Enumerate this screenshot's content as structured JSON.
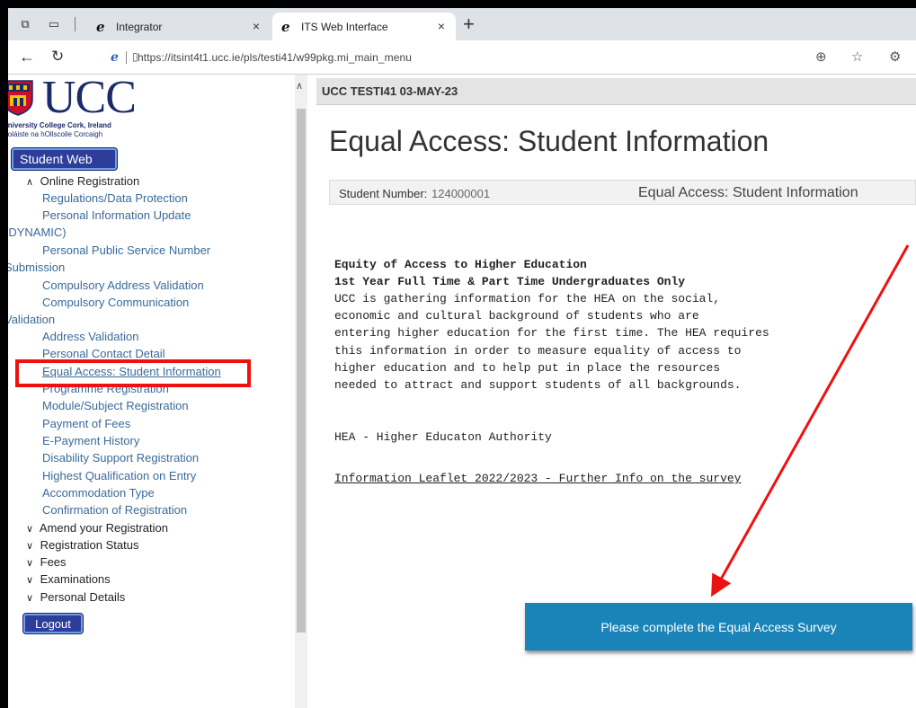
{
  "browser": {
    "tabs": [
      {
        "label": "Integrator",
        "close": "×"
      },
      {
        "label": "ITS Web Interface",
        "close": "×"
      }
    ],
    "new_tab": "+",
    "url": "https://itsint4t1.ucc.ie/pls/testi41/w99pkg.mi_main_menu"
  },
  "logo": {
    "name": "UCC",
    "sub1": "University College Cork, Ireland",
    "sub2": "Coláiste na hOllscoile Corcaigh"
  },
  "sidebar": {
    "student_web": "Student Web",
    "online_registration": "Online Registration",
    "items": [
      "Regulations/Data Protection",
      "Personal Information Update",
      "(DYNAMIC)",
      "Personal Public Service Number",
      "Submission",
      "Compulsory Address Validation",
      "Compulsory Communication",
      "Validation",
      "Address Validation",
      "Personal Contact Detail",
      "Equal Access: Student Information",
      "Programme Registration",
      "Module/Subject Registration",
      "Payment of Fees",
      "E-Payment History",
      "Disability Support Registration",
      "Highest Qualification on Entry",
      "Accommodation Type",
      "Confirmation of Registration"
    ],
    "sections": [
      "Amend your Registration",
      "Registration Status",
      "Fees",
      "Examinations",
      "Personal Details"
    ],
    "logout": "Logout"
  },
  "main": {
    "header": "UCC TESTI41 03-MAY-23",
    "title": "Equal Access: Student Information",
    "student_number_label": "Student Number:",
    "student_number": "124000001",
    "info_right": "Equal Access: Student Information",
    "heading1": "Equity of Access to Higher Education",
    "heading2": "1st Year Full Time & Part Time Undergraduates Only",
    "body_lines": [
      "UCC is gathering information for the HEA on the social,",
      "economic and cultural background of students who are",
      "entering higher education for the first time. The HEA requires",
      "this information in order to measure equality of access to",
      "higher education and to help put in place the resources",
      "needed to attract and support students of all backgrounds."
    ],
    "hea": "HEA - Higher Educaton Authority",
    "leaflet": "Information Leaflet 2022/2023 - Further Info on the survey",
    "survey_button": "Please complete the Equal Access Survey"
  },
  "colors": {
    "link": "#3a6a9a",
    "highlight": "#ee1111",
    "survey_button": "#1a84b8",
    "brand": "#1b2a6b"
  }
}
